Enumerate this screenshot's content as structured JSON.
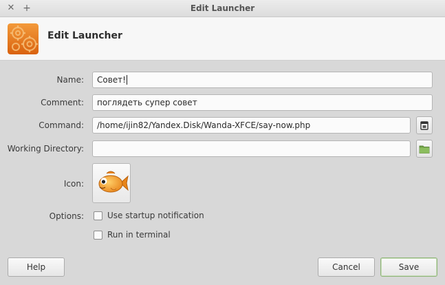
{
  "window": {
    "title": "Edit Launcher"
  },
  "header": {
    "title": "Edit Launcher"
  },
  "form": {
    "name_label": "Name:",
    "name_value": "Совет!",
    "comment_label": "Comment:",
    "comment_value": "поглядеть супер совет",
    "command_label": "Command:",
    "command_value": "/home/ijin82/Yandex.Disk/Wanda-XFCE/say-now.php",
    "workdir_label": "Working Directory:",
    "workdir_value": "",
    "icon_label": "Icon:",
    "options_label": "Options:",
    "startup_notification_label": "Use startup notification",
    "run_in_terminal_label": "Run in terminal"
  },
  "buttons": {
    "help": "Help",
    "cancel": "Cancel",
    "save": "Save"
  },
  "icons": {
    "close": "close-icon",
    "maximize": "maximize-icon",
    "app": "gears-icon",
    "browse_command": "browse-file-icon",
    "browse_folder": "folder-icon",
    "launcher": "fish-icon"
  },
  "colors": {
    "accent_save_border": "#8fb47a",
    "app_icon": "#e8761c",
    "folder_icon": "#76a84c"
  }
}
